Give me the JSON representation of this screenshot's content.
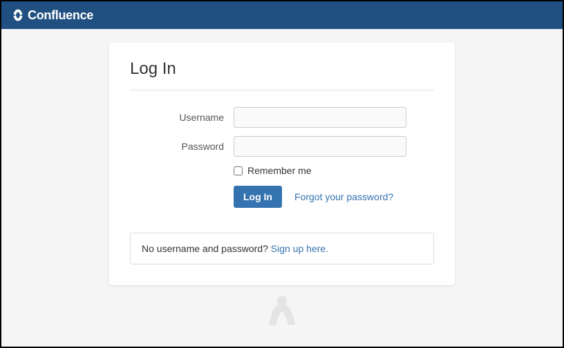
{
  "header": {
    "brand": "Confluence"
  },
  "card": {
    "title": "Log In"
  },
  "form": {
    "username_label": "Username",
    "password_label": "Password",
    "remember_label": "Remember me",
    "login_button": "Log In",
    "forgot_link": "Forgot your password?"
  },
  "signup": {
    "prompt": "No username and password? ",
    "link": "Sign up here."
  }
}
